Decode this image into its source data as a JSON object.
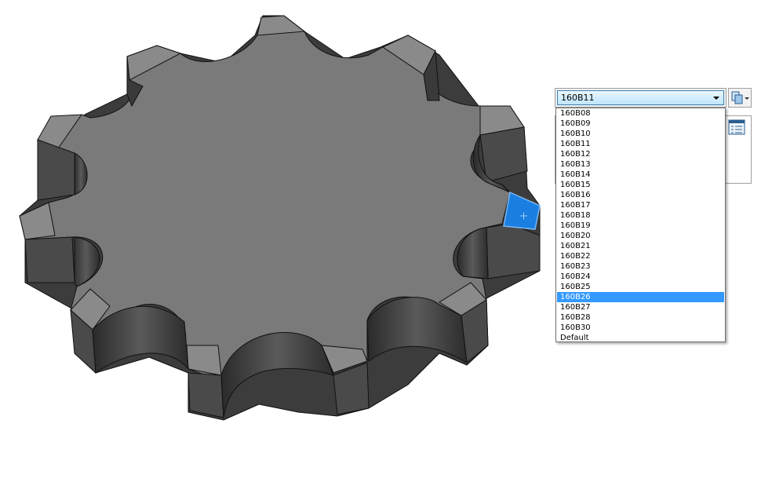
{
  "config_selector": {
    "current_value": "160B11",
    "options": [
      "160B08",
      "160B09",
      "160B10",
      "160B11",
      "160B12",
      "160B13",
      "160B14",
      "160B15",
      "160B16",
      "160B17",
      "160B18",
      "160B19",
      "160B20",
      "160B21",
      "160B22",
      "160B23",
      "160B24",
      "160B25",
      "160B26",
      "160B27",
      "160B28",
      "160B30",
      "Default"
    ],
    "highlighted_option": "160B26"
  },
  "colors": {
    "gear_top": "#797979",
    "gear_side": "#3e3e3e",
    "selection": "#1a7fe0",
    "highlight": "#3399ff"
  },
  "icons": {
    "config_button": "configuration-icon",
    "list_view": "list-view-icon",
    "selection_marker": "plus-icon"
  }
}
